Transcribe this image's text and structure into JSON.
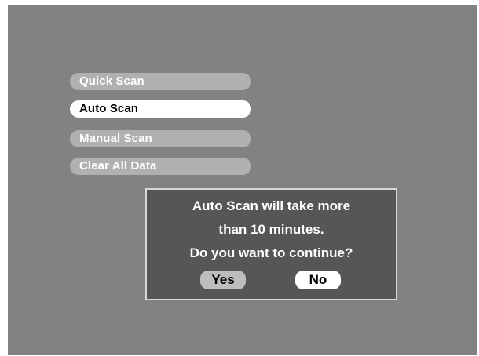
{
  "menu": {
    "items": [
      {
        "label": "Quick Scan",
        "selected": false
      },
      {
        "label": "Auto Scan",
        "selected": true
      },
      {
        "label": "Manual Scan",
        "selected": false
      },
      {
        "label": "Clear All Data",
        "selected": false
      }
    ]
  },
  "dialog": {
    "lines": [
      "Auto Scan will take more",
      "than 10 minutes.",
      "Do you want to continue?"
    ],
    "yes_label": "Yes",
    "no_label": "No"
  },
  "colors": {
    "screen_background": "#828282",
    "menu_item_inactive": "#b0b0b0",
    "menu_item_selected": "#ffffff",
    "dialog_background": "#565656",
    "dialog_border": "#d8d8d8"
  }
}
